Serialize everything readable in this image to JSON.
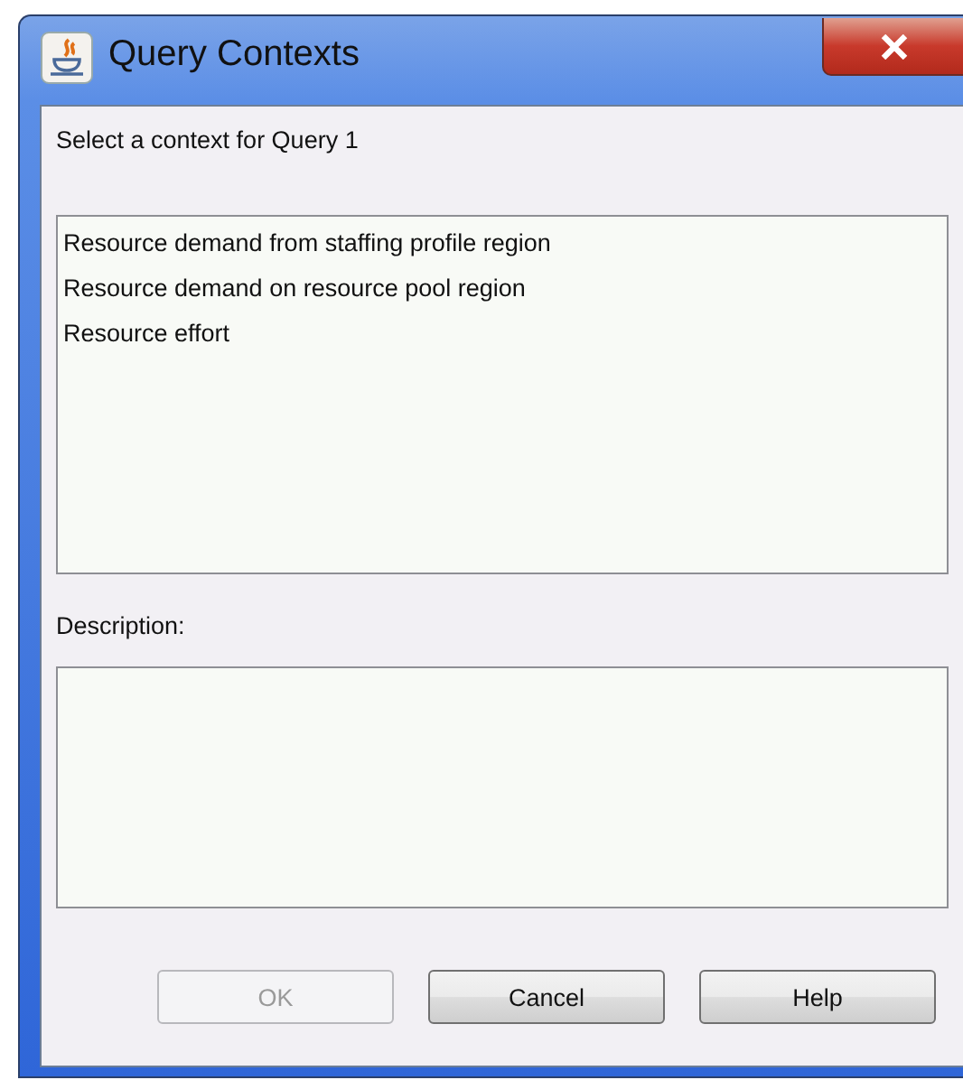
{
  "window": {
    "title": "Query Contexts"
  },
  "prompt": "Select a context for Query 1",
  "contexts": [
    {
      "label": "Resource demand from staffing profile region",
      "selected": false
    },
    {
      "label": "Resource demand on resource pool region",
      "selected": false
    },
    {
      "label": "Resource effort",
      "selected": false
    }
  ],
  "description": {
    "label": "Description:"
  },
  "buttons": [
    {
      "label": "OK",
      "disabled": true
    },
    {
      "label": "Cancel",
      "disabled": false
    },
    {
      "label": "Help",
      "disabled": false
    }
  ]
}
